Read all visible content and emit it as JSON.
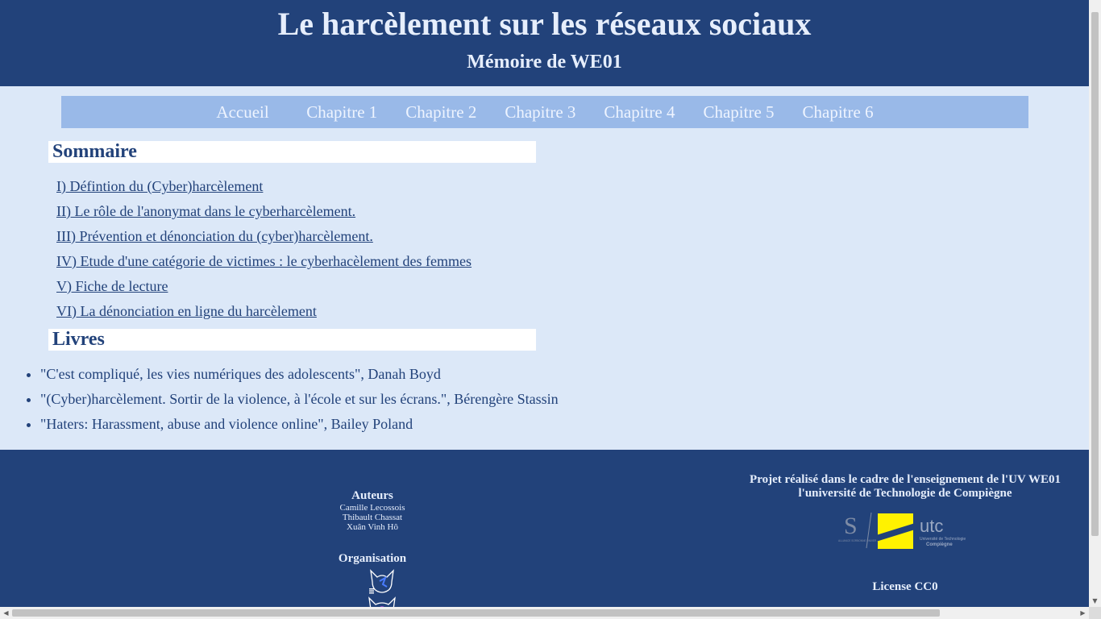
{
  "header": {
    "title": "Le harcèlement sur les réseaux sociaux",
    "subtitle": "Mémoire de WE01"
  },
  "nav": {
    "items": [
      {
        "label": "Accueil"
      },
      {
        "label": "Chapitre 1"
      },
      {
        "label": "Chapitre 2"
      },
      {
        "label": "Chapitre 3"
      },
      {
        "label": "Chapitre 4"
      },
      {
        "label": "Chapitre 5"
      },
      {
        "label": "Chapitre 6"
      }
    ]
  },
  "summary": {
    "heading": "Sommaire",
    "items": [
      {
        "label": "I) Défintion du (Cyber)harcèlement"
      },
      {
        "label": "II) Le rôle de l'anonymat dans le cyberharcèlement."
      },
      {
        "label": "III) Prévention et dénonciation du (cyber)harcèlement."
      },
      {
        "label": "IV) Etude d'une catégorie de victimes : le cyberhacèlement des femmes"
      },
      {
        "label": "V) Fiche de lecture"
      },
      {
        "label": "VI) La dénonciation en ligne du harcèlement"
      }
    ]
  },
  "books": {
    "heading": "Livres",
    "items": [
      {
        "label": "\"C'est compliqué, les vies numériques des adolescents\", Danah Boyd"
      },
      {
        "label": "\"(Cyber)harcèlement. Sortir de la violence, à l'école et sur les écrans.\", Bérengère Stassin"
      },
      {
        "label": "\"Haters: Harassment, abuse and violence online\", Bailey Poland"
      }
    ]
  },
  "footer": {
    "authors_heading": "Auteurs",
    "authors": [
      "Camille Lecossois",
      "Thibault Chassat",
      "Xuân Vinh Hô"
    ],
    "organisation_heading": "Organisation",
    "project_line1": "Projet réalisé dans le cadre de l'enseignement de l'UV WE01",
    "project_line2": "l'université de Technologie de Compiègne",
    "license": "License CC0",
    "utc_logo_text": "utc",
    "utc_logo_subtext_1": "Université de Technologie",
    "utc_logo_subtext_2": "Compiègne",
    "sorbonne_logo_text": "ALLIANCE SORBONNE UNIVERSITÉ"
  },
  "colors": {
    "primary": "#22427a",
    "page_background": "#dce8f8",
    "nav_background": "#99b9e8",
    "utc_yellow": "#fff200"
  },
  "icons": {
    "organisation_logos": [
      "cat-head-icon",
      "cat-head-icon"
    ],
    "scroll_arrows": [
      "triangle-down-icon",
      "triangle-left-icon",
      "triangle-right-icon"
    ]
  }
}
